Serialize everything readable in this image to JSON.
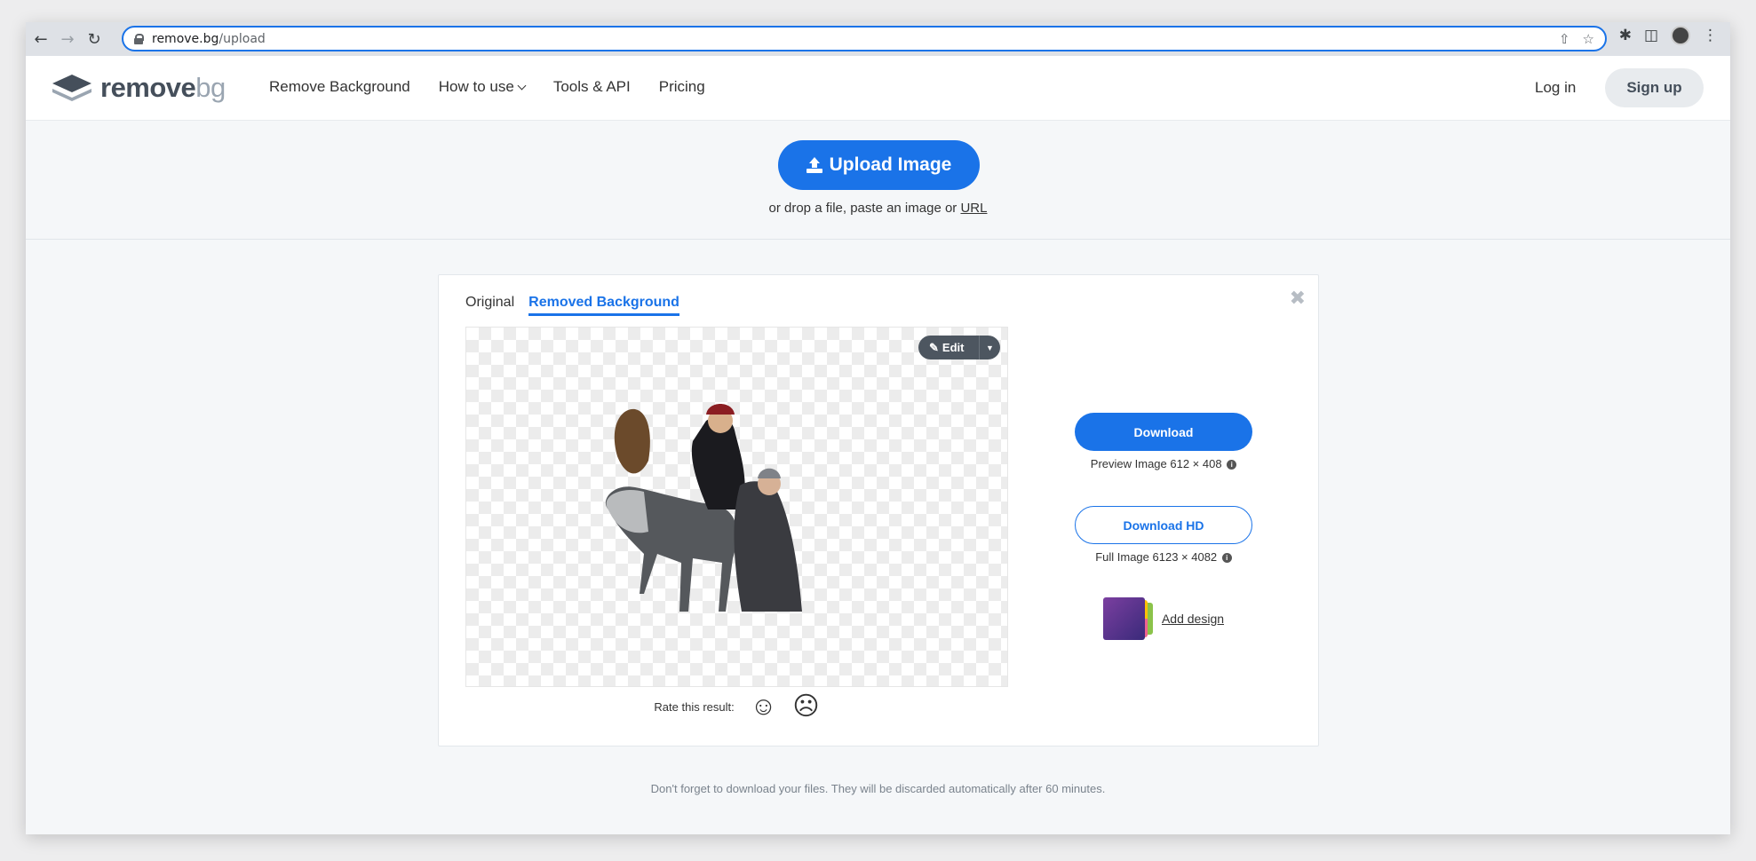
{
  "browser": {
    "url_host": "remove.bg",
    "url_path": "/upload"
  },
  "header": {
    "logo_word1": "remove",
    "logo_word2": "bg",
    "nav": [
      "Remove Background",
      "How to use",
      "Tools & API",
      "Pricing"
    ],
    "login": "Log in",
    "signup": "Sign up"
  },
  "upload": {
    "button": "Upload Image",
    "hint_prefix": "or drop a file, paste an image or ",
    "hint_link": "URL"
  },
  "result": {
    "tabs": [
      "Original",
      "Removed Background"
    ],
    "active_tab": "Removed Background",
    "edit_label": "Edit",
    "rate_label": "Rate this result:",
    "download_label": "Download",
    "preview_note": "Preview Image 612 × 408",
    "download_hd_label": "Download HD",
    "full_note": "Full Image 6123 × 4082",
    "add_design": "Add design"
  },
  "footer": {
    "note": "Don't forget to download your files. They will be discarded automatically after 60 minutes."
  },
  "colors": {
    "accent": "#1a73e8",
    "page_bg": "#f5f7f9"
  }
}
